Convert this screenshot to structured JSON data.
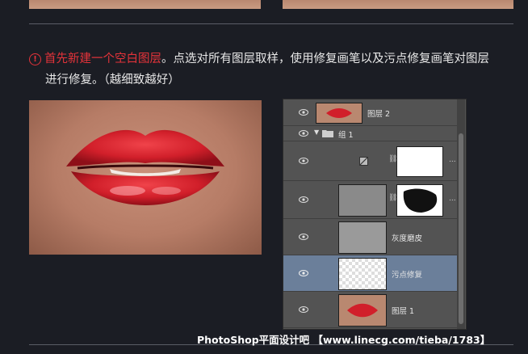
{
  "instruction": {
    "step_badge": "!",
    "highlight": "首先新建一个空白图层",
    "text": "。点选对所有图层取样，使用修复画笔以及污点修复画笔对图层",
    "text_line2": "进行修复。（越细致越好）"
  },
  "layers_panel": {
    "layers": [
      {
        "name": "图层 2",
        "type": "image",
        "selected": false
      },
      {
        "name": "组 1",
        "type": "group",
        "selected": false
      },
      {
        "name": "",
        "type": "adjustment",
        "selected": false
      },
      {
        "name": "",
        "type": "masked",
        "selected": false
      },
      {
        "name": "灰度磨皮",
        "type": "image",
        "selected": false
      },
      {
        "name": "污点修复",
        "type": "image",
        "selected": true
      },
      {
        "name": "图层 1",
        "type": "image",
        "selected": false
      }
    ],
    "more_glyph": "..."
  },
  "watermark": "PhotoShop平面设计吧 【www.linecg.com/tieba/1783】",
  "colors": {
    "background": "#1b1d24",
    "accent": "#e4333a",
    "selection": "#6b7f9a"
  }
}
